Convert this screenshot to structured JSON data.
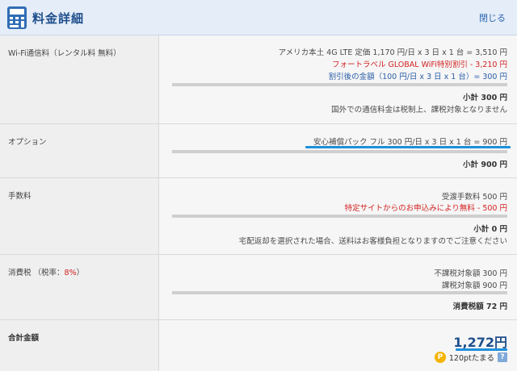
{
  "header": {
    "title": "料金詳細",
    "close_label": "閉じる"
  },
  "wifi": {
    "label": "Wi-Fi通信料（レンタル料 無料）",
    "line1": "アメリカ本土 4G LTE 定価 1,170 円/日 x 3 日 x 1 台 = 3,510 円",
    "line2": "フォートラベル GLOBAL WiFi特別割引 - 3,210 円",
    "line3": "割引後の金額（100 円/日 x 3 日 x 1 台）= 300 円",
    "subtotal": "小計 300 円",
    "note": "国外での通信料金は税制上、課税対象となりません"
  },
  "option": {
    "label": "オプション",
    "line1": "安心補償パック フル 300 円/日 x 3 日 x 1 台 = 900 円",
    "subtotal": "小計 900 円"
  },
  "fee": {
    "label": "手数料",
    "line1": "受渡手数料 500 円",
    "line2": "特定サイトからのお申込みにより無料 - 500 円",
    "subtotal": "小計 0 円",
    "note": "宅配返却を選択された場合、送料はお客様負担となりますのでご注意ください"
  },
  "tax": {
    "label_prefix": "消費税 （税率：",
    "rate": "8%",
    "label_suffix": "）",
    "line1": "不課税対象額 300 円",
    "line2": "課税対象額 900 円",
    "subtotal": "消費税額 72 円"
  },
  "total": {
    "label": "合計金額",
    "amount": "1,272円",
    "points": "120ptたまる",
    "points_icon": "P",
    "help_icon": "?"
  },
  "colors": {
    "header_bg": "#e4edf8",
    "title": "#1f4f8c",
    "red": "#d32222",
    "blue": "#2b5fa8",
    "accent_underline": "#1e8fdc",
    "point_coin": "#f5b400"
  }
}
